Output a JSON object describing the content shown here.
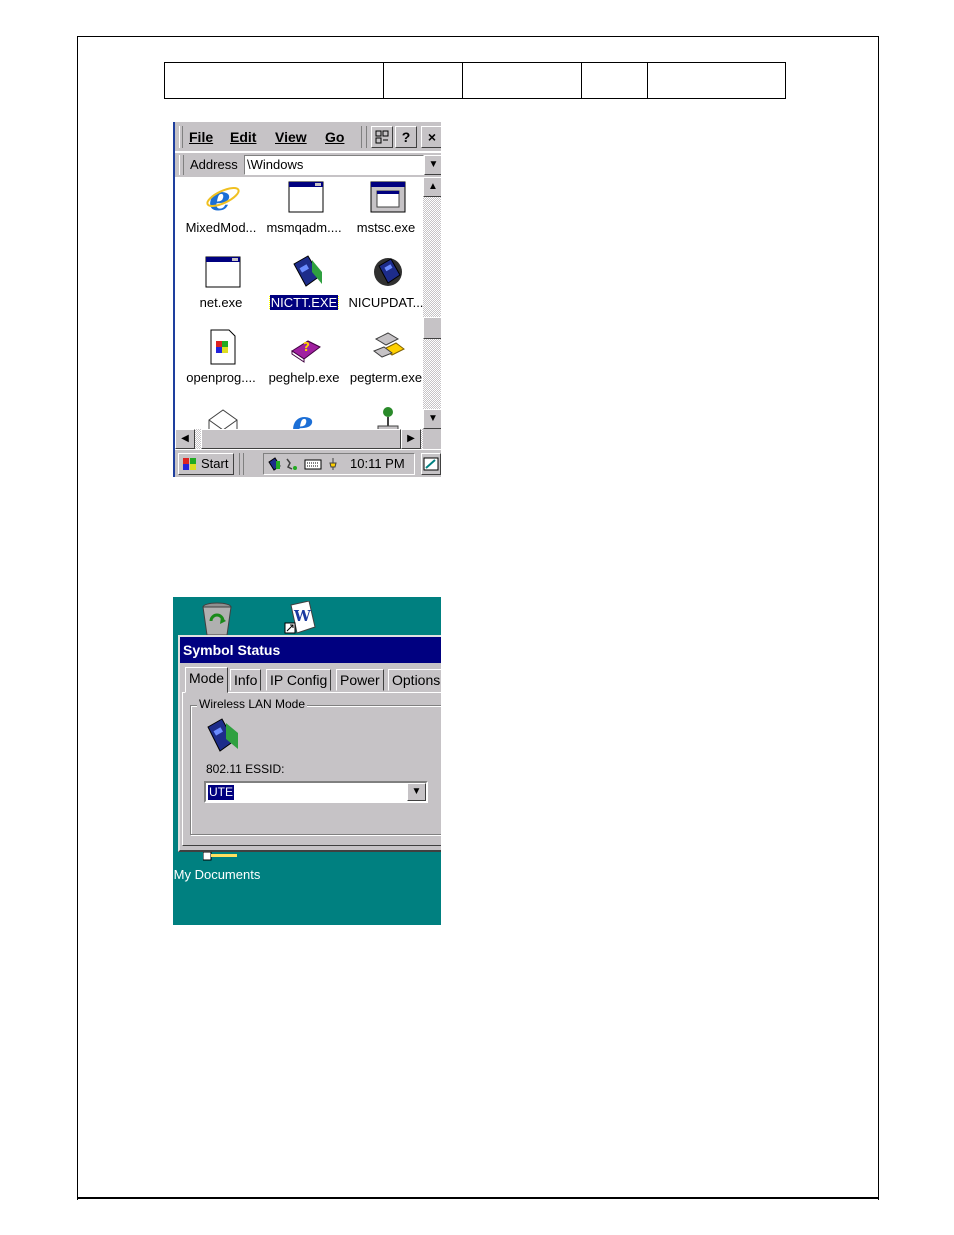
{
  "header_table": {
    "cells": [
      "",
      "",
      "",
      "",
      ""
    ]
  },
  "explorer": {
    "menu": [
      "File",
      "Edit",
      "View",
      "Go"
    ],
    "help_button": "?",
    "close_button": "×",
    "address_label": "Address",
    "address_value": "\\Windows",
    "files": [
      {
        "label": "MixedMod...",
        "icon": "ie-icon"
      },
      {
        "label": "msmqadm....",
        "icon": "window-app-icon"
      },
      {
        "label": "mstsc.exe",
        "icon": "window-app-icon"
      },
      {
        "label": "net.exe",
        "icon": "window-app-icon"
      },
      {
        "label": "NICTT.EXE",
        "icon": "network-card-icon",
        "selected": true
      },
      {
        "label": "NICUPDAT...",
        "icon": "network-card-gear-icon"
      },
      {
        "label": "openprog....",
        "icon": "document-icon"
      },
      {
        "label": "peghelp.exe",
        "icon": "help-book-icon"
      },
      {
        "label": "pegterm.exe",
        "icon": "terminal-icon"
      }
    ],
    "taskbar": {
      "start_label": "Start",
      "clock": "10:11 PM"
    }
  },
  "symbol_status": {
    "title": "Symbol Status",
    "tabs": [
      "Mode",
      "Info",
      "IP Config",
      "Power",
      "Options"
    ],
    "active_tab": "Mode",
    "group_label": "Wireless LAN Mode",
    "essid_label": "802.11 ESSID:",
    "essid_value": "UTE",
    "desktop_icon_label": "My Documents",
    "colors": {
      "desktop": "#008080",
      "titlebar": "#000080",
      "face": "#c6c3c6"
    }
  }
}
